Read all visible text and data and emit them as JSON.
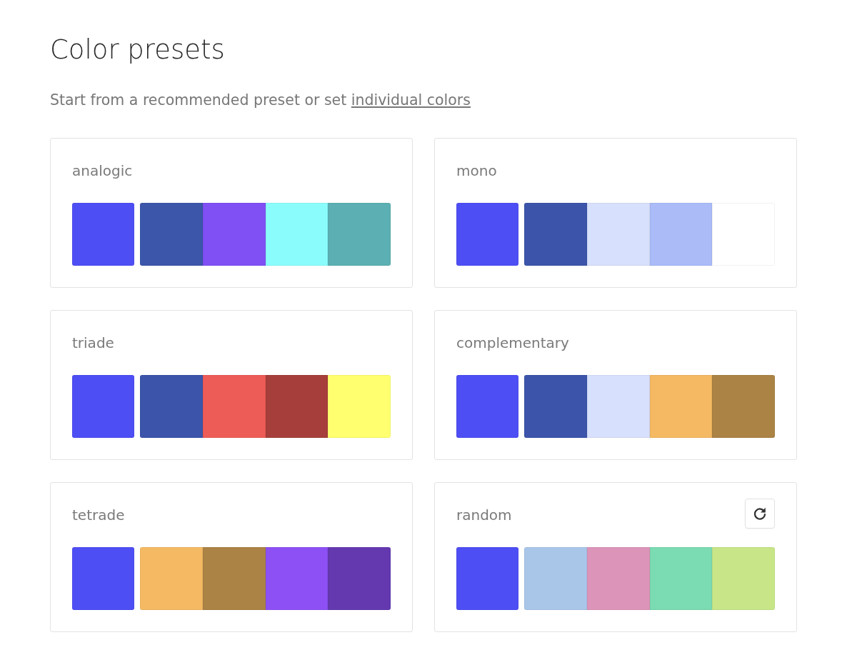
{
  "title": "Color presets",
  "intro": {
    "text": "Start from a recommended preset or set ",
    "link": "individual colors"
  },
  "presets": [
    {
      "name": "analogic",
      "refresh_button": false,
      "base": {
        "color": "#4e4ef5"
      },
      "palette": [
        {
          "color": "#3c56aa"
        },
        {
          "color": "#8050f5"
        },
        {
          "color": "#8afcfc"
        },
        {
          "color": "#5cb0b3"
        }
      ]
    },
    {
      "name": "mono",
      "refresh_button": false,
      "base": {
        "color": "#4e4ef5"
      },
      "palette": [
        {
          "color": "#3c55aa"
        },
        {
          "color": "#d7e0fc"
        },
        {
          "color": "#aabbf8"
        },
        {
          "color": "#ffffff"
        }
      ]
    },
    {
      "name": "triade",
      "refresh_button": false,
      "base": {
        "color": "#4e4ef5"
      },
      "palette": [
        {
          "color": "#3c55aa"
        },
        {
          "color": "#ee5c57"
        },
        {
          "color": "#a63f3b"
        },
        {
          "color": "#ffff6f"
        }
      ]
    },
    {
      "name": "complementary",
      "refresh_button": false,
      "base": {
        "color": "#4e4ef5"
      },
      "palette": [
        {
          "color": "#3c55aa"
        },
        {
          "color": "#d7e0fc"
        },
        {
          "color": "#f4b962"
        },
        {
          "color": "#ab8345"
        }
      ]
    },
    {
      "name": "tetrade",
      "refresh_button": false,
      "base": {
        "color": "#4e4ef5"
      },
      "palette": [
        {
          "color": "#f4b962"
        },
        {
          "color": "#ab8345"
        },
        {
          "color": "#8c50f5"
        },
        {
          "color": "#6439b0"
        }
      ]
    },
    {
      "name": "random",
      "refresh_button": true,
      "base": {
        "color": "#4e4ef5"
      },
      "palette": [
        {
          "color": "#a9c6e9"
        },
        {
          "color": "#dd94b9"
        },
        {
          "color": "#7bdbb2"
        },
        {
          "color": "#c8e688"
        }
      ]
    }
  ]
}
